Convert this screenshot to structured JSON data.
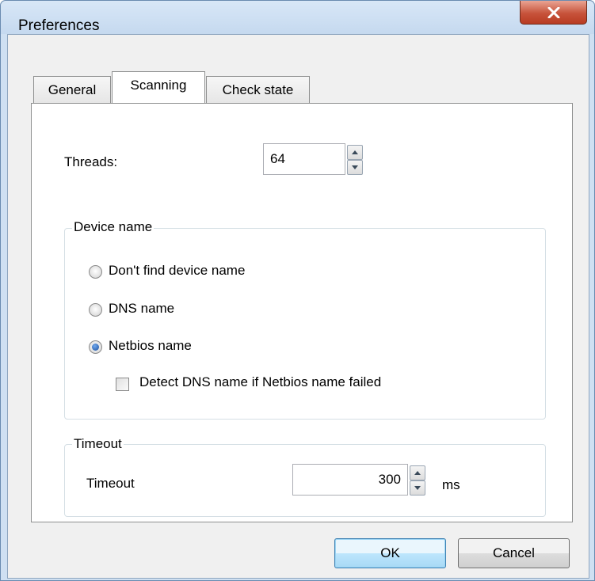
{
  "window": {
    "title": "Preferences"
  },
  "tabs": [
    {
      "label": "General"
    },
    {
      "label": "Scanning"
    },
    {
      "label": "Check state"
    }
  ],
  "scanning": {
    "threads_label": "Threads:",
    "threads_value": "64",
    "device_name": {
      "group_label": "Device name",
      "options": [
        {
          "label": "Don't find device name",
          "checked": false
        },
        {
          "label": "DNS name",
          "checked": false
        },
        {
          "label": "Netbios name",
          "checked": true
        }
      ],
      "fallback_checkbox": {
        "label": "Detect DNS name if Netbios name failed",
        "checked": false
      }
    },
    "timeout": {
      "group_label": "Timeout",
      "label": "Timeout",
      "value": "300",
      "unit": "ms"
    }
  },
  "buttons": {
    "ok": "OK",
    "cancel": "Cancel"
  },
  "colors": {
    "close_button": "#c7533b",
    "default_button_border": "#3c7fb1",
    "title_bar": "#cfe0f2"
  },
  "icons": {
    "close": "close-icon",
    "spin_up": "spin-up-arrow-icon",
    "spin_down": "spin-down-arrow-icon"
  }
}
